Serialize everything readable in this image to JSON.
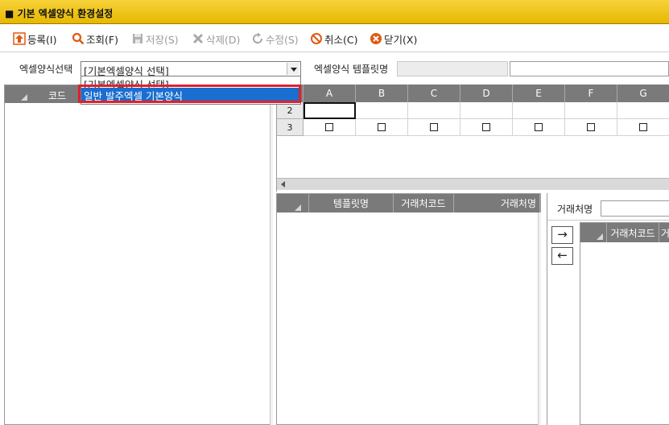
{
  "window": {
    "title": "■ 기본 엑셀양식 환경설정"
  },
  "toolbar": {
    "register": "등록(I)",
    "search": "조회(F)",
    "save": "저장(S)",
    "delete": "삭제(D)",
    "edit": "수정(S)",
    "cancel": "취소(C)",
    "close": "닫기(X)"
  },
  "filter": {
    "excel_form_label": "엑셀양식선택",
    "excel_form_value": "[기본엑셀양식 선택]",
    "template_name_label": "엑셀양식 템플릿명",
    "dropdown_options": [
      "[기본엑셀양식 선택]",
      "일반 발주엑셀 기본양식"
    ]
  },
  "left_grid": {
    "header": "코드"
  },
  "sheet_grid": {
    "columns": [
      "A",
      "B",
      "C",
      "D",
      "E",
      "F",
      "G"
    ],
    "rows": [
      "2",
      "3"
    ]
  },
  "template_grid": {
    "columns": [
      "템플릿명",
      "거래처코드",
      "거래처명"
    ]
  },
  "right_panel": {
    "client_name_label": "거래처명",
    "arrow_right": "→",
    "arrow_left": "←",
    "grid_columns": [
      "거래처코드",
      "거"
    ]
  },
  "colors": {
    "titlebar": "#f0c419",
    "header": "#7a7a7a",
    "selection": "#1a6ecf",
    "highlight": "#e0202a"
  }
}
